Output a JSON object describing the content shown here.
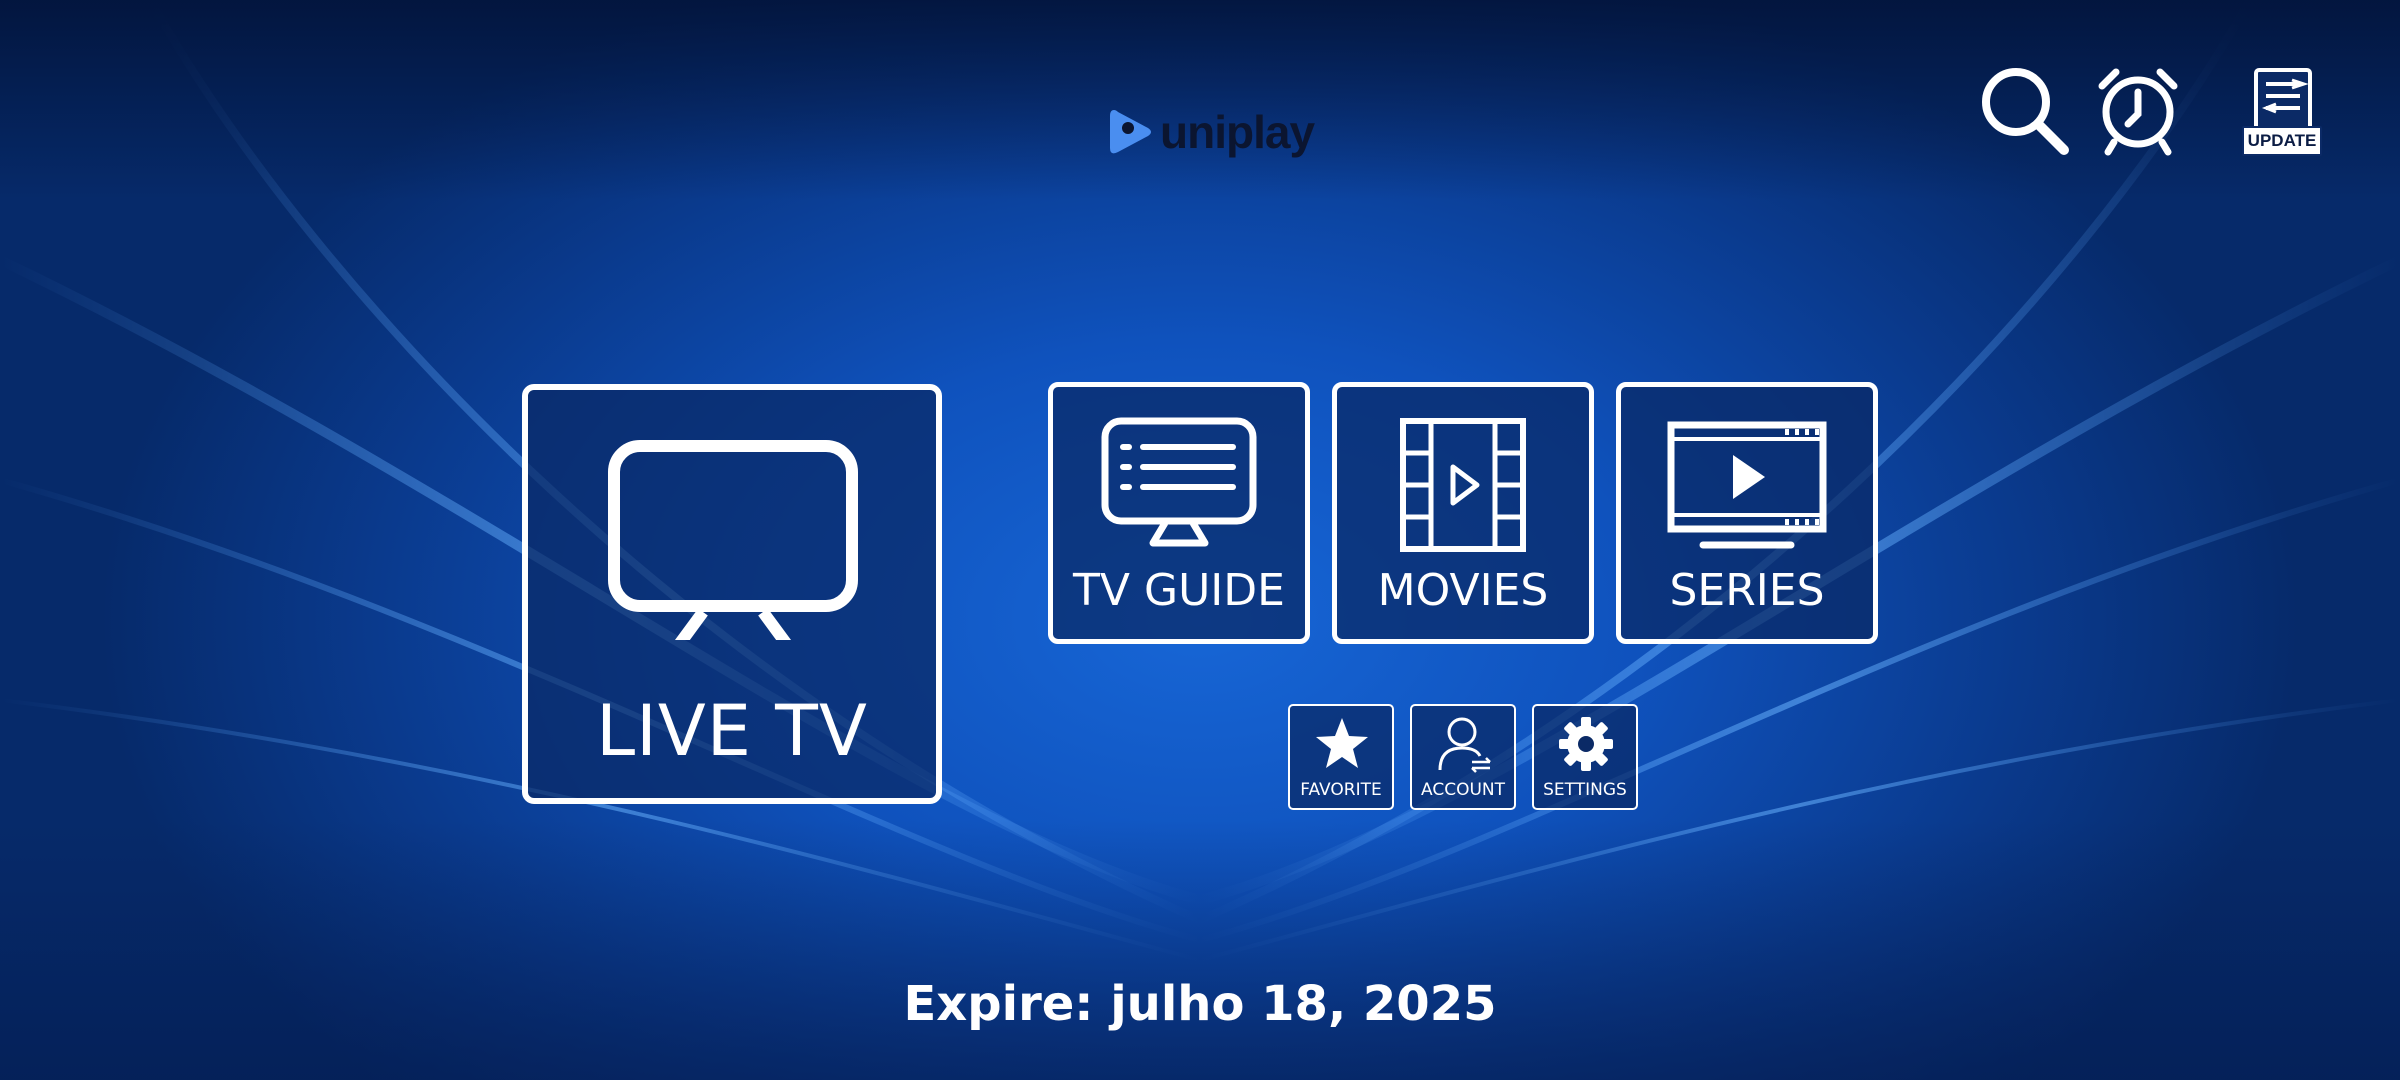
{
  "app": {
    "logo_text": "uniplay"
  },
  "top_bar": {
    "search_icon": "search-icon",
    "alarm_icon": "alarm-clock-icon",
    "update_label": "UPDATE"
  },
  "tiles": {
    "live_tv": {
      "label": "LIVE TV",
      "icon": "tv-monitor-icon"
    },
    "tv_guide": {
      "label": "TV GUIDE",
      "icon": "tv-guide-icon"
    },
    "movies": {
      "label": "MOVIES",
      "icon": "film-strip-icon"
    },
    "series": {
      "label": "SERIES",
      "icon": "video-player-icon"
    },
    "favorite": {
      "label": "FAVORITE",
      "icon": "star-icon"
    },
    "account": {
      "label": "ACCOUNT",
      "icon": "user-icon"
    },
    "settings": {
      "label": "SETTINGS",
      "icon": "gear-icon"
    }
  },
  "footer": {
    "expire_text": "Expire: julho 18, 2025"
  },
  "colors": {
    "background": "#0f52bd",
    "tile_border": "#ffffff",
    "logo_accent": "#4a8ef0"
  }
}
